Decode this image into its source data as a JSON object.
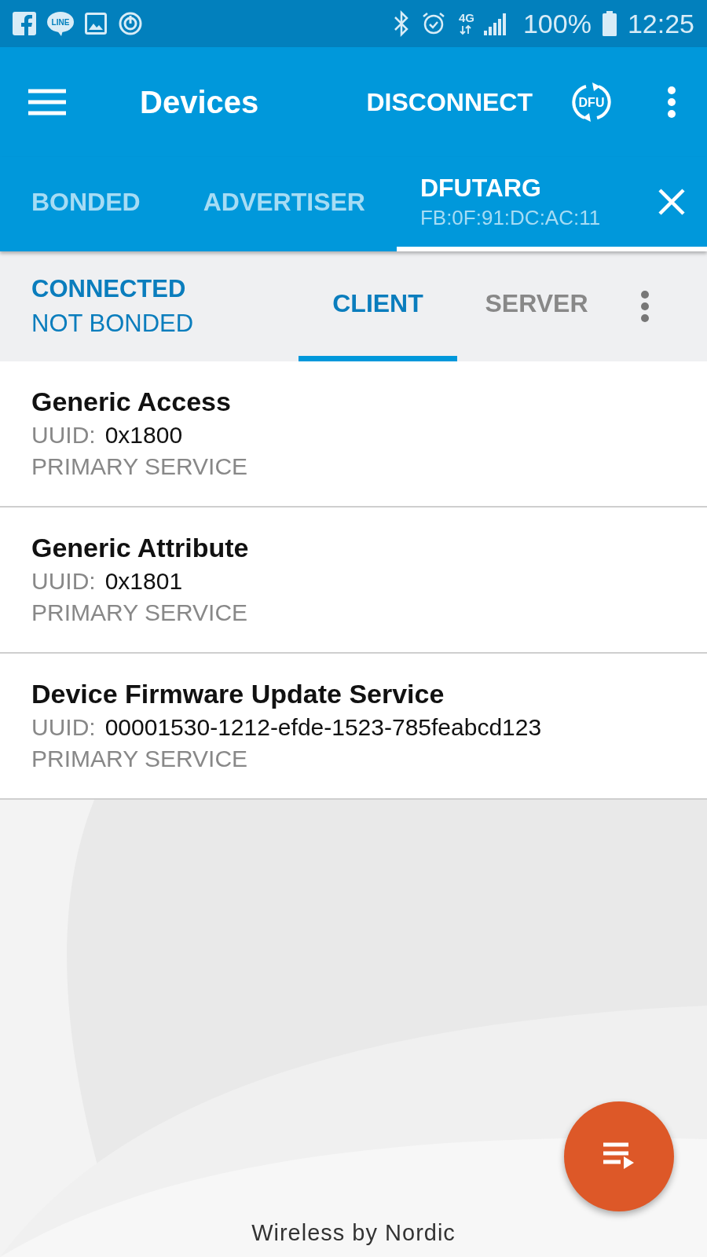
{
  "status_bar": {
    "line_label": "LINE",
    "network": "4G",
    "battery": "100%",
    "time": "12:25"
  },
  "toolbar": {
    "title": "Devices",
    "action": "DISCONNECT",
    "dfu_label": "DFU"
  },
  "device_tabs": [
    {
      "kind": "plain",
      "label": "BONDED",
      "selected": false
    },
    {
      "kind": "plain",
      "label": "ADVERTISER",
      "selected": false
    },
    {
      "kind": "device",
      "label": "DFUTARG",
      "address": "FB:0F:91:DC:AC:11",
      "selected": true
    }
  ],
  "connection": {
    "state": "CONNECTED",
    "bond": "NOT BONDED"
  },
  "role_tabs": [
    {
      "label": "CLIENT",
      "selected": true
    },
    {
      "label": "SERVER",
      "selected": false
    }
  ],
  "services": [
    {
      "name": "Generic Access",
      "uuid_label": "UUID:",
      "uuid": "0x1800",
      "type": "PRIMARY SERVICE"
    },
    {
      "name": "Generic Attribute",
      "uuid_label": "UUID:",
      "uuid": "0x1801",
      "type": "PRIMARY SERVICE"
    },
    {
      "name": "Device Firmware Update Service",
      "uuid_label": "UUID:",
      "uuid": "00001530-1212-efde-1523-785feabcd123",
      "type": "PRIMARY SERVICE"
    }
  ],
  "footer": "Wireless by Nordic"
}
